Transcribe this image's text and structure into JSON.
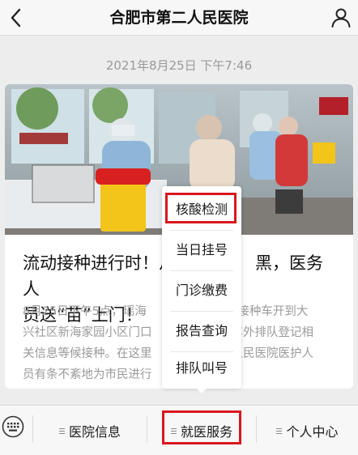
{
  "header": {
    "title": "合肥市第二人民医院",
    "back_icon": "chevron-left-icon",
    "profile_icon": "person-icon"
  },
  "message": {
    "timestamp": "2021年8月25日 下午7:46",
    "title": "流动接种进行时！从早到黑，医务人员送“苗”上门！",
    "summary": "8月25日下午5点，瑶海区流动疫苗接种车开到大兴社区新海家园小区门口，居民在车外排队登记相关信息等候接种。在这里，合肥市第二人民医院医护人员有条不紊地为市民进行疫苗接种。",
    "visible_title_lines": [
      "流动接种进行时！从",
      "黑，医务人",
      "员送“苗”上门！"
    ],
    "visible_summary_lines": [
      [
        "8月25日下午5点，瑶海",
        "苗接种车开到大"
      ],
      [
        "兴社区新海家园小区门口",
        "车外排队登记相"
      ],
      [
        "关信息等候接种。在这里",
        "人民医院医护人"
      ],
      [
        "员有条不紊地为市民进行",
        ""
      ]
    ]
  },
  "submenu": {
    "items": [
      "核酸检测",
      "当日挂号",
      "门诊缴费",
      "报告查询",
      "排队叫号"
    ],
    "highlighted_index": 0
  },
  "bottom_menu": {
    "keyboard_icon": "keyboard-icon",
    "tabs": [
      "医院信息",
      "就医服务",
      "个人中心"
    ],
    "highlighted_index": 1
  },
  "colors": {
    "highlight_border": "#d9161e",
    "background": "#ededed",
    "timestamp_text": "#9a9a9a"
  }
}
